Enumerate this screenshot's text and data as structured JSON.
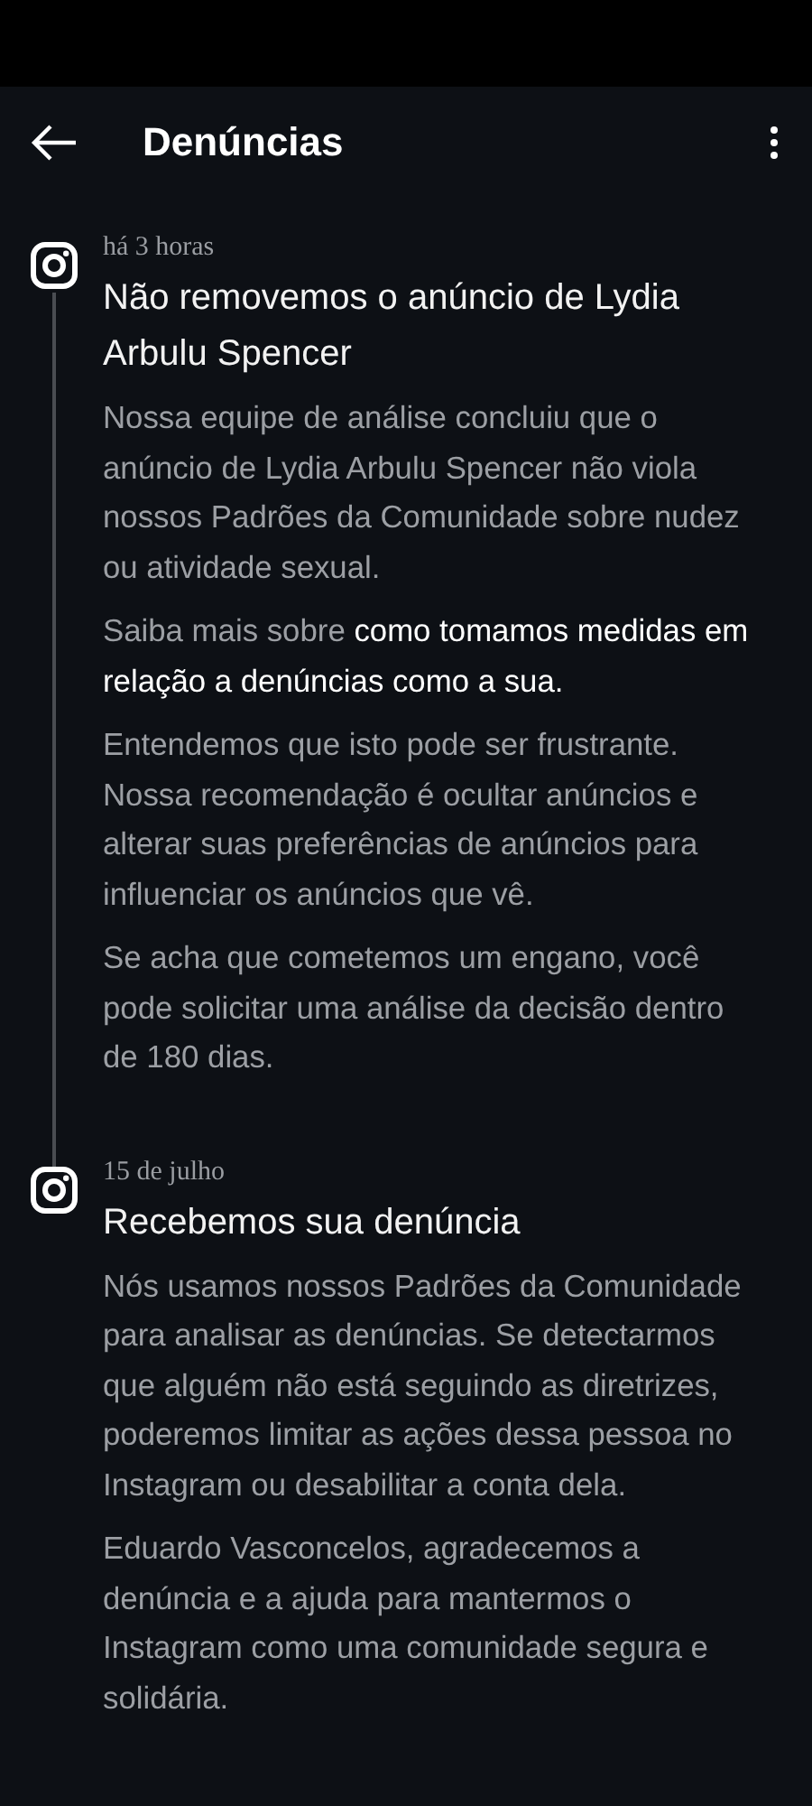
{
  "header": {
    "title": "Denúncias"
  },
  "events": [
    {
      "date": "há 3 horas",
      "title": "Não removemos o anúncio de Lydia Arbulu Spencer",
      "paragraphs": [
        {
          "text": "Nossa equipe de análise concluiu que o anúncio de Lydia Arbulu Spencer não viola nossos Padrões da Comunidade sobre nudez ou atividade sexual."
        },
        {
          "text": "Saiba mais sobre ",
          "link_lines": [
            "como tomamos medidas em",
            "relação a denúncias como a sua."
          ]
        },
        {
          "text": "Entendemos que isto pode ser frustrante. Nossa recomendação é ocultar anúncios e alterar suas preferências de anúncios para influenciar os anúncios que vê."
        },
        {
          "text": "Se acha que cometemos um engano, você pode solicitar uma análise da decisão dentro de 180 dias."
        }
      ]
    },
    {
      "date": "15 de julho",
      "title": "Recebemos sua denúncia",
      "paragraphs": [
        {
          "text": "Nós usamos nossos Padrões da Comunidade para analisar as denúncias. Se detectarmos que alguém não está seguindo as diretrizes, poderemos limitar as ações dessa pessoa no Instagram ou desabilitar a conta dela."
        },
        {
          "text": "Eduardo Vasconcelos, agradecemos a denúncia e a ajuda para mantermos o Instagram como uma comunidade segura e solidária."
        }
      ]
    }
  ]
}
